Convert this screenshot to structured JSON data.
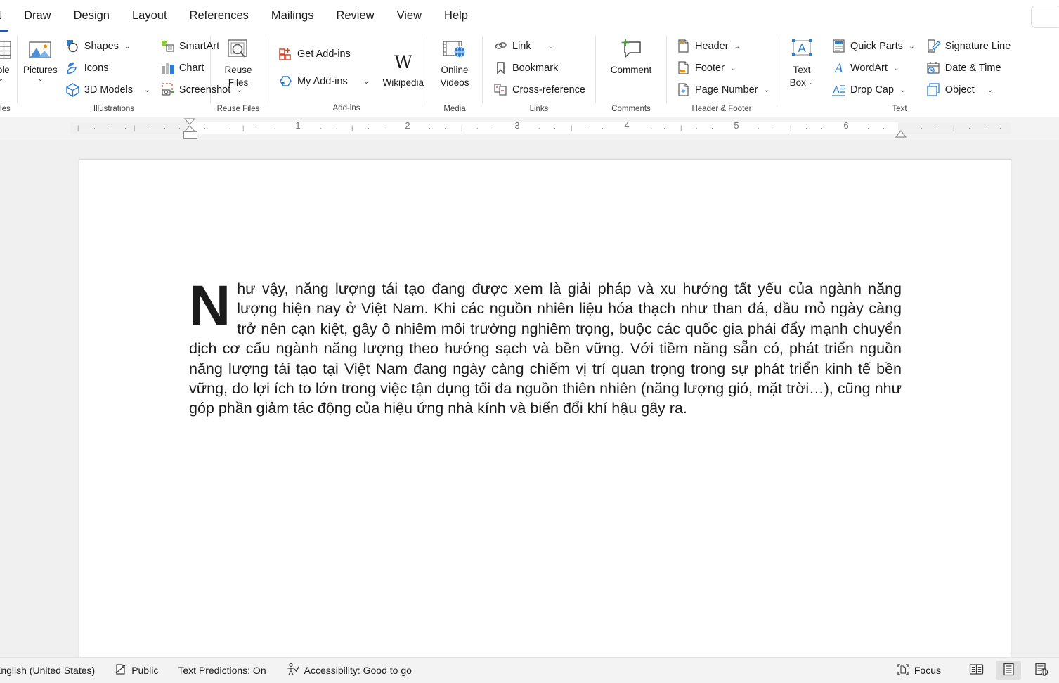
{
  "tabs": [
    {
      "label": "rt",
      "active": true,
      "clipped": true,
      "name": "tab-insert"
    },
    {
      "label": "Draw",
      "active": false,
      "name": "tab-draw"
    },
    {
      "label": "Design",
      "active": false,
      "name": "tab-design"
    },
    {
      "label": "Layout",
      "active": false,
      "name": "tab-layout"
    },
    {
      "label": "References",
      "active": false,
      "name": "tab-references"
    },
    {
      "label": "Mailings",
      "active": false,
      "name": "tab-mailings"
    },
    {
      "label": "Review",
      "active": false,
      "name": "tab-review"
    },
    {
      "label": "View",
      "active": false,
      "name": "tab-view"
    },
    {
      "label": "Help",
      "active": false,
      "name": "tab-help"
    }
  ],
  "ribbon": {
    "groups": {
      "tables": {
        "label": "ables",
        "table_label": "able"
      },
      "illustrations": {
        "label": "Illustrations",
        "pictures": "Pictures",
        "shapes": "Shapes",
        "icons": "Icons",
        "models3d": "3D Models",
        "smartart": "SmartArt",
        "chart": "Chart",
        "screenshot": "Screenshot"
      },
      "reuse": {
        "label": "Reuse Files",
        "button_line1": "Reuse",
        "button_line2": "Files"
      },
      "addins": {
        "label": "Add-ins",
        "get_addins": "Get Add-ins",
        "my_addins": "My Add-ins",
        "wikipedia": "Wikipedia"
      },
      "media": {
        "label": "Media",
        "online_line1": "Online",
        "online_line2": "Videos"
      },
      "links": {
        "label": "Links",
        "link": "Link",
        "bookmark": "Bookmark",
        "cross_reference": "Cross-reference"
      },
      "comments": {
        "label": "Comments",
        "comment": "Comment"
      },
      "headerfooter": {
        "label": "Header & Footer",
        "header": "Header",
        "footer": "Footer",
        "page_number": "Page Number"
      },
      "text": {
        "label": "Text",
        "textbox_line1": "Text",
        "textbox_line2": "Box",
        "quick_parts": "Quick Parts",
        "wordart": "WordArt",
        "drop_cap": "Drop Cap",
        "signature_line": "Signature Line",
        "date_time": "Date & Time",
        "object": "Object"
      }
    }
  },
  "ruler": {
    "numbers": [
      "1",
      "2",
      "3",
      "4",
      "5",
      "6"
    ]
  },
  "document": {
    "dropcap": "N",
    "paragraph": "hư vậy, năng lượng tái tạo đang được xem là giải pháp và xu hướng tất yếu của ngành năng lượng hiện nay ở Việt Nam. Khi các nguồn nhiên liệu hóa thạch như than đá, dầu mỏ ngày càng trở nên cạn kiệt, gây ô nhiêm môi trường nghiêm trọng, buộc các quốc gia phải đẩy mạnh chuyển dịch cơ cấu ngành năng lượng theo hướng sạch và bền vững. Với tiềm năng sẵn có, phát triển nguồn năng lượng tái tạo tại Việt Nam đang ngày càng chiếm vị trí quan trọng trong sự phát triển kinh tế bền vững, do lợi ích to lớn trong việc tận dụng tối đa nguồn thiên nhiên (năng lượng gió, mặt trời…), cũng như góp phần giảm tác động của hiệu ứng nhà kính và biến đổi khí hậu gây ra."
  },
  "status": {
    "language": "English (United States)",
    "sensitivity": "Public",
    "text_predictions": "Text Predictions: On",
    "accessibility": "Accessibility: Good to go",
    "focus": "Focus"
  },
  "colors": {
    "accent": "#2b579a",
    "icon_blue": "#2b579a",
    "icon_light_blue": "#4a90d9",
    "icon_orange": "#d14524",
    "icon_green": "#3f9c35",
    "page_bg": "#ffffff",
    "canvas_bg": "#f0f0f0",
    "chrome_bg": "#f3f3f3"
  }
}
